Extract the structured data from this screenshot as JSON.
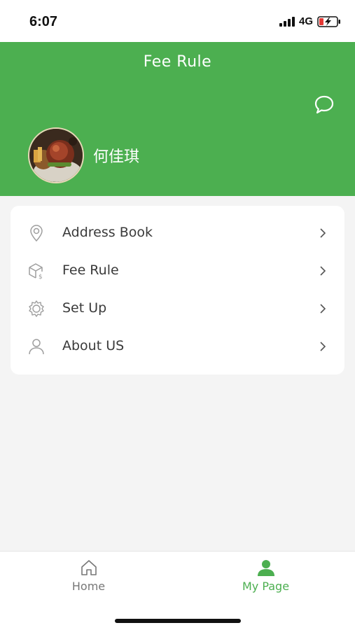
{
  "status_bar": {
    "time": "6:07",
    "network": "4G",
    "icons": [
      "signal-icon",
      "battery-charging-icon"
    ]
  },
  "header": {
    "title": "Fee Rule",
    "user_name": "何佳琪",
    "icons": [
      "chat-bubble-icon",
      "avatar"
    ]
  },
  "menu": {
    "items": [
      {
        "label": "Address Book",
        "icon": "location-pin-icon"
      },
      {
        "label": "Fee Rule",
        "icon": "box-dollar-icon"
      },
      {
        "label": "Set Up",
        "icon": "gear-icon"
      },
      {
        "label": "About US",
        "icon": "person-icon"
      }
    ]
  },
  "tab_bar": {
    "tabs": [
      {
        "label": "Home",
        "icon": "home-icon",
        "active": false
      },
      {
        "label": "My Page",
        "icon": "person-filled-icon",
        "active": true
      }
    ]
  },
  "colors": {
    "brand_green": "#4caf50",
    "background": "#f4f4f4",
    "card": "#ffffff",
    "text": "#3a3a3a",
    "inactive_tab": "#777777"
  }
}
